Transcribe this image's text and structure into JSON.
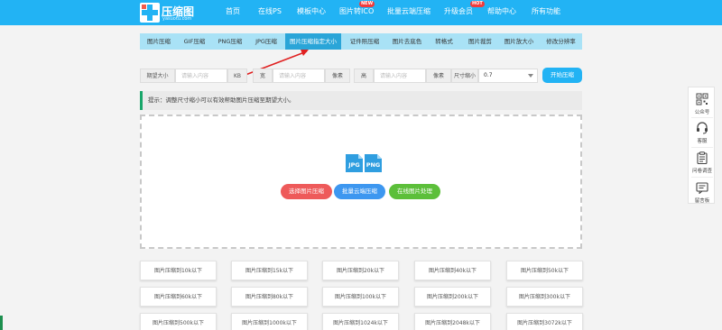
{
  "header": {
    "logo_title": "压缩图",
    "logo_subtitle": "yasuotu.com",
    "nav": [
      {
        "label": "首页"
      },
      {
        "label": "在线PS"
      },
      {
        "label": "模板中心"
      },
      {
        "label": "图片转ICO",
        "badge": "NEW"
      },
      {
        "label": "批量云端压缩"
      },
      {
        "label": "升级会员",
        "badge": "HOT"
      },
      {
        "label": "帮助中心"
      },
      {
        "label": "所有功能"
      }
    ],
    "accent_color": "#22b3f4",
    "badge_color": "#f23b3b"
  },
  "tabs": [
    {
      "label": "图片压缩"
    },
    {
      "label": "GIF压缩"
    },
    {
      "label": "PNG压缩"
    },
    {
      "label": "JPG压缩"
    },
    {
      "label": "图片压缩指定大小",
      "active": true
    },
    {
      "label": "证件照压缩"
    },
    {
      "label": "图片去底色"
    },
    {
      "label": "转格式"
    },
    {
      "label": "图片裁剪"
    },
    {
      "label": "图片放大小"
    },
    {
      "label": "修改分辨率"
    }
  ],
  "form": {
    "expected_size_label": "期望大小",
    "expected_size_placeholder": "请输入内容",
    "expected_size_unit": "KB",
    "width_label": "宽",
    "width_placeholder": "请输入内容",
    "width_unit": "像素",
    "height_label": "高",
    "height_placeholder": "请输入内容",
    "height_unit": "像素",
    "scale_label": "尺寸缩小",
    "scale_value": "0.7",
    "start_button": "开始压缩"
  },
  "tip": "提示：调整尺寸缩小可以有效帮助图片压缩至期望大小。",
  "dropzone": {
    "icon_left": "JPG",
    "icon_right": "PNG",
    "buttons": [
      {
        "label": "选择图片压缩",
        "color": "#ee5a5a"
      },
      {
        "label": "批量云端压缩",
        "color": "#3d97f0"
      },
      {
        "label": "在线图片处理",
        "color": "#5cbf3a"
      }
    ]
  },
  "size_buttons": [
    "图片压缩到10k以下",
    "图片压缩到15k以下",
    "图片压缩到20k以下",
    "图片压缩到40k以下",
    "图片压缩到50k以下",
    "图片压缩到60k以下",
    "图片压缩到80k以下",
    "图片压缩到100k以下",
    "图片压缩到200k以下",
    "图片压缩到300k以下",
    "图片压缩到500k以下",
    "图片压缩到1000k以下",
    "图片压缩到1024k以下",
    "图片压缩到2048k以下",
    "图片压缩到3072k以下"
  ],
  "sidebar": [
    {
      "label": "公众号",
      "icon": "qrcode-icon"
    },
    {
      "label": "客服",
      "icon": "headset-icon"
    },
    {
      "label": "问卷调查",
      "icon": "clipboard-icon"
    },
    {
      "label": "留言板",
      "icon": "message-board-icon"
    }
  ]
}
